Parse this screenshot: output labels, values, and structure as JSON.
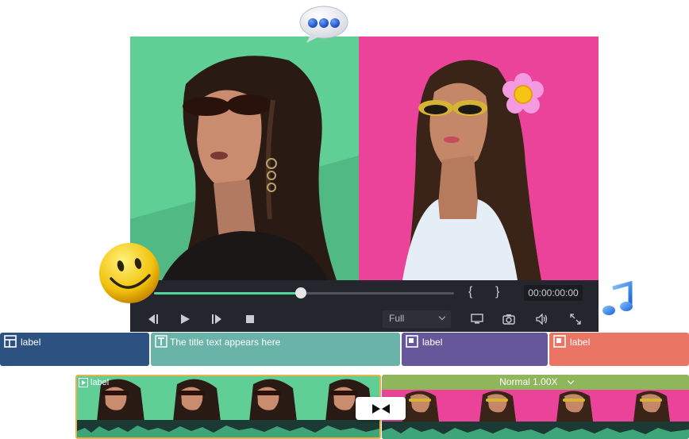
{
  "controls": {
    "brace_open": "{",
    "brace_close": "}",
    "timecode": "00:00:00:00",
    "progress": 0.49,
    "quality_label": "Full"
  },
  "tracks": [
    {
      "label": "label",
      "color": "#2d5282",
      "icon": "layout-icon"
    },
    {
      "label": "The title text appears here",
      "color": "#69b3a9",
      "icon": "text-icon"
    },
    {
      "label": "label",
      "color": "#66579b",
      "icon": "overlay-icon"
    },
    {
      "label": "label",
      "color": "#ea7565",
      "icon": "overlay-icon"
    }
  ],
  "timeline": {
    "clip_a_label": "label",
    "clip_b_speed": "Normal 1.00X"
  },
  "colors": {
    "accent": "#52d49a",
    "panel": "#24262d",
    "clip_selected": "#e8b34c",
    "clip_b": "#8fb65a"
  },
  "icons": [
    "speech-bubble-icon",
    "smiley-sticker-icon",
    "music-note-icon",
    "flower-sticker-icon",
    "rewind-icon",
    "play-icon",
    "step-forward-icon",
    "stop-icon",
    "monitor-icon",
    "camera-icon",
    "volume-icon",
    "fullscreen-icon",
    "transition-icon"
  ]
}
